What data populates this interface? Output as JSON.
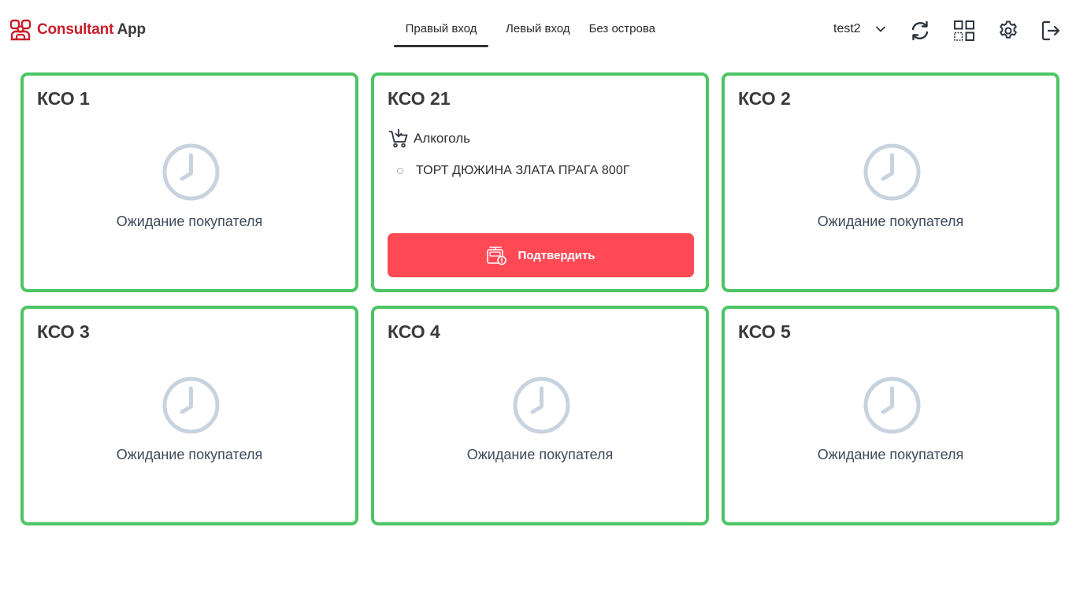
{
  "app": {
    "title_part1": "Consultant",
    "title_part2": "App",
    "brand_color": "#c81e2a"
  },
  "tabs": [
    {
      "label": "Правый вход",
      "active": true
    },
    {
      "label": "Левый вход",
      "active": false
    },
    {
      "label": "Без острова",
      "active": false
    }
  ],
  "user": {
    "name": "test2"
  },
  "toolbar_icons": [
    "refresh-icon",
    "qr-code-icon",
    "settings-icon",
    "logout-icon"
  ],
  "status_color": "#4cc564",
  "kso": [
    {
      "title": "КСО 1",
      "status": "Ожидание покупателя"
    },
    {
      "title": "КСО 21",
      "category": "Алкоголь",
      "item": "ТОРТ ДЮЖИНА ЗЛАТА ПРАГА 800Г",
      "button": "Подтвердить",
      "button_color": "#ff4a55"
    },
    {
      "title": "КСО 2",
      "status": "Ожидание покупателя"
    },
    {
      "title": "КСО 3",
      "status": "Ожидание покупателя"
    },
    {
      "title": "КСО 4",
      "status": "Ожидание покупателя"
    },
    {
      "title": "КСО 5",
      "status": "Ожидание покупателя"
    }
  ]
}
